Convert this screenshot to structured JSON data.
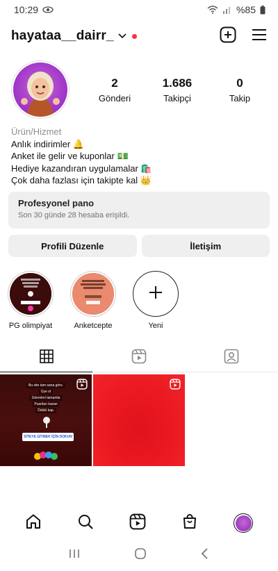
{
  "status": {
    "time": "10:29",
    "battery": "%85"
  },
  "profile": {
    "username": "hayataa__dairr_",
    "stats": [
      {
        "num": "2",
        "label": "Gönderi"
      },
      {
        "num": "1.686",
        "label": "Takipçi"
      },
      {
        "num": "0",
        "label": "Takip"
      }
    ],
    "category": "Ürün/Hizmet",
    "bio": [
      "Anlık indirimler 🔔",
      "Anket ile gelir ve kuponlar 💵",
      "Hediye kazandıran uygulamalar 🛍️",
      "Çok daha fazlası için takipte  kal 👑"
    ]
  },
  "dashboard": {
    "title": "Profesyonel pano",
    "subtitle": "Son 30 günde 28 hesaba erişildi."
  },
  "buttons": {
    "edit": "Profili Düzenle",
    "contact": "İletişim"
  },
  "highlights": [
    {
      "name": "PG olimpiyat"
    },
    {
      "name": "Anketcepte"
    },
    {
      "name": "Yeni"
    }
  ],
  "post1": {
    "lines": [
      "Bu site tam sana göre.",
      "Üye ol",
      "Görevleri tamamla",
      "Puanları kazan",
      "Ödülü kap."
    ],
    "cta": "SİTEYE GİTMEK İÇİN DOKUN"
  },
  "colors": {
    "accent_red": "#ff3040",
    "button_bg": "#efefef"
  }
}
